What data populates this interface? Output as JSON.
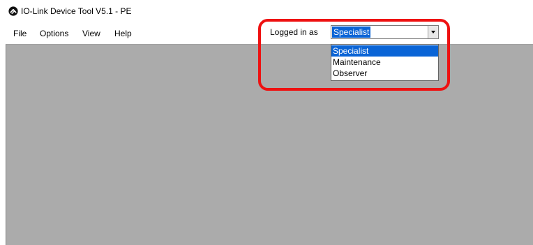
{
  "window": {
    "title": "IO-Link Device Tool V5.1 - PE",
    "icon": "app-logo-icon"
  },
  "menu": {
    "items": [
      {
        "label": "File"
      },
      {
        "label": "Options"
      },
      {
        "label": "View"
      },
      {
        "label": "Help"
      }
    ]
  },
  "login": {
    "label": "Logged in as",
    "selected": "Specialist",
    "options": [
      "Specialist",
      "Maintenance",
      "Observer"
    ],
    "dropdown_open": true
  },
  "colors": {
    "selection": "#0a64d6",
    "workspace": "#ababab",
    "annotation": "#ee1111"
  }
}
